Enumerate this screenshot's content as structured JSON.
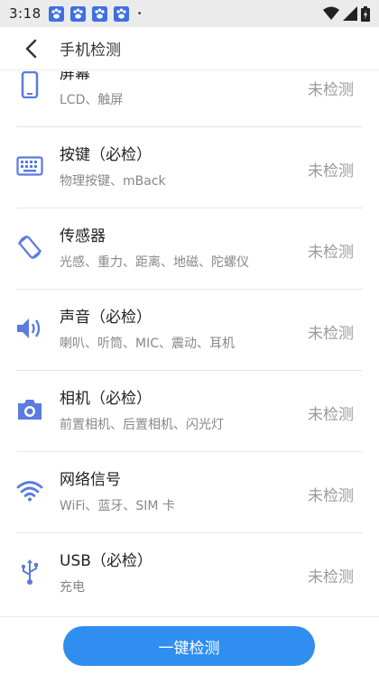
{
  "status_bar": {
    "time": "3:18",
    "dot": "•"
  },
  "app_bar": {
    "title": "手机检测"
  },
  "items": [
    {
      "title": "屏幕",
      "subtitle": "LCD、触屏",
      "status": "未检测",
      "icon": "phone-icon"
    },
    {
      "title": "按键（必检）",
      "subtitle": "物理按键、mBack",
      "status": "未检测",
      "icon": "keyboard-icon"
    },
    {
      "title": "传感器",
      "subtitle": "光感、重力、距离、地磁、陀螺仪",
      "status": "未检测",
      "icon": "rotate-screen-icon"
    },
    {
      "title": "声音（必检）",
      "subtitle": "喇叭、听筒、MIC、震动、耳机",
      "status": "未检测",
      "icon": "speaker-icon"
    },
    {
      "title": "相机（必检）",
      "subtitle": "前置相机、后置相机、闪光灯",
      "status": "未检测",
      "icon": "camera-icon"
    },
    {
      "title": "网络信号",
      "subtitle": "WiFi、蓝牙、SIM 卡",
      "status": "未检测",
      "icon": "wifi-icon"
    },
    {
      "title": "USB（必检）",
      "subtitle": "充电",
      "status": "未检测",
      "icon": "usb-icon"
    }
  ],
  "bottom": {
    "button_label": "一键检测"
  },
  "colors": {
    "accent": "#2f8ef0",
    "icon": "#5b7be0",
    "status_text": "#9a9a9a"
  }
}
